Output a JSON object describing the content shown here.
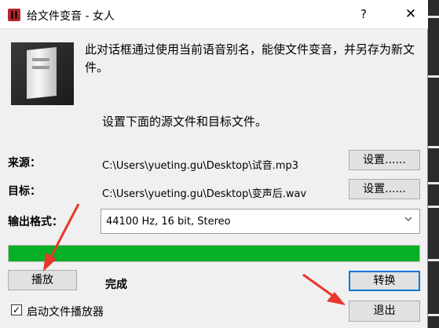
{
  "window": {
    "title": "给文件变音 - 女人",
    "help_label": "?",
    "close_label": "✕"
  },
  "description": "此对话框通过使用当前语音别名，能使文件变音，并另存为新文件。",
  "instruction": "设置下面的源文件和目标文件。",
  "source": {
    "label": "来源：",
    "path": "C:\\Users\\yueting.gu\\Desktop\\试音.mp3",
    "button": "设置......"
  },
  "target": {
    "label": "目标：",
    "path": "C:\\Users\\yueting.gu\\Desktop\\变声后.wav",
    "button": "设置......"
  },
  "format": {
    "label": "输出格式：",
    "selected": "44100 Hz, 16 bit, Stereo"
  },
  "progress": {
    "fraction": 1.0,
    "color": "#06b025"
  },
  "play_button": "播放",
  "status": "完成",
  "convert_button": "转换",
  "exit_button": "退出",
  "autoplay_checkbox": {
    "label": "启动文件播放器",
    "checked": true
  },
  "annotation_color": "#e8372c"
}
